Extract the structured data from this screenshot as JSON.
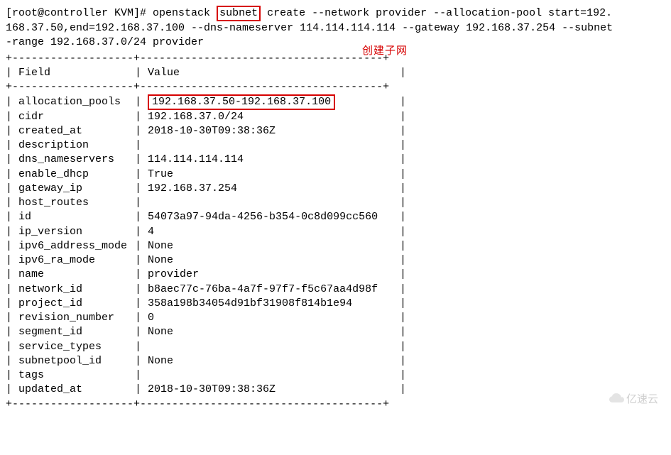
{
  "prompt": "[root@controller KVM]# ",
  "cmd_part1": "openstack ",
  "cmd_subnet": "subnet",
  "cmd_part2": " create --network provider  --allocation-pool start=192.",
  "cmd_line2": "168.37.50,end=192.168.37.100 --dns-nameserver 114.114.114.114 --gateway 192.168.37.254 --subnet",
  "cmd_line3": "-range 192.168.37.0/24 provider",
  "annotation": "创建子网",
  "sep_line": "+-------------------+--------------------------------------+",
  "header": {
    "field": "Field",
    "value": "Value"
  },
  "rows": [
    {
      "field": "allocation_pools",
      "value": "192.168.37.50-192.168.37.100",
      "highlight": true
    },
    {
      "field": "cidr",
      "value": "192.168.37.0/24"
    },
    {
      "field": "created_at",
      "value": "2018-10-30T09:38:36Z"
    },
    {
      "field": "description",
      "value": ""
    },
    {
      "field": "dns_nameservers",
      "value": "114.114.114.114"
    },
    {
      "field": "enable_dhcp",
      "value": "True"
    },
    {
      "field": "gateway_ip",
      "value": "192.168.37.254"
    },
    {
      "field": "host_routes",
      "value": ""
    },
    {
      "field": "id",
      "value": "54073a97-94da-4256-b354-0c8d099cc560"
    },
    {
      "field": "ip_version",
      "value": "4"
    },
    {
      "field": "ipv6_address_mode",
      "value": "None"
    },
    {
      "field": "ipv6_ra_mode",
      "value": "None"
    },
    {
      "field": "name",
      "value": "provider"
    },
    {
      "field": "network_id",
      "value": "b8aec77c-76ba-4a7f-97f7-f5c67aa4d98f"
    },
    {
      "field": "project_id",
      "value": "358a198b34054d91bf31908f814b1e94"
    },
    {
      "field": "revision_number",
      "value": "0"
    },
    {
      "field": "segment_id",
      "value": "None"
    },
    {
      "field": "service_types",
      "value": ""
    },
    {
      "field": "subnetpool_id",
      "value": "None"
    },
    {
      "field": "tags",
      "value": ""
    },
    {
      "field": "updated_at",
      "value": "2018-10-30T09:38:36Z"
    }
  ],
  "watermark": "亿速云"
}
